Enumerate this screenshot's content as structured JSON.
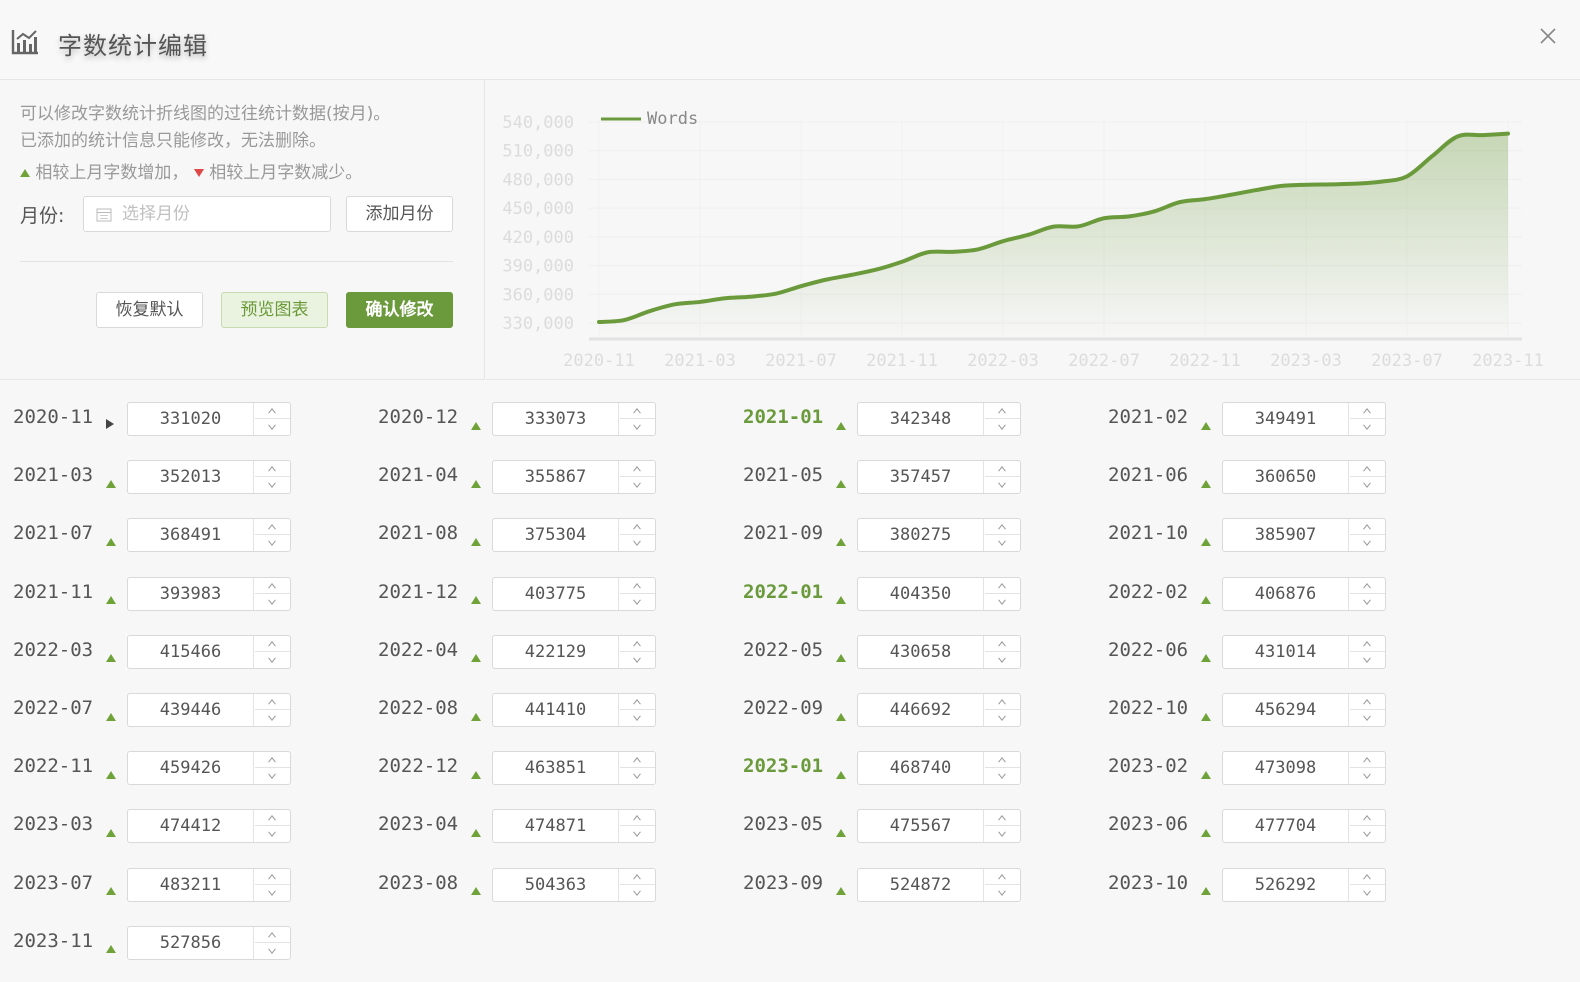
{
  "header": {
    "title": "字数统计编辑"
  },
  "panel": {
    "desc1": "可以修改字数统计折线图的过往统计数据(按月)。",
    "desc2": "已添加的统计信息只能修改，无法删除。",
    "legend_up": "相较上月字数增加，",
    "legend_down": "相较上月字数减少。",
    "month_label": "月份:",
    "month_placeholder": "选择月份",
    "add_month": "添加月份",
    "reset": "恢复默认",
    "preview": "预览图表",
    "confirm": "确认修改"
  },
  "colors": {
    "accent": "#6b9a3c",
    "up": "#6fa33a",
    "down": "#e04848"
  },
  "entries": [
    {
      "month": "2020-11",
      "value": "331020",
      "trend": "flat"
    },
    {
      "month": "2020-12",
      "value": "333073",
      "trend": "up"
    },
    {
      "month": "2021-01",
      "value": "342348",
      "trend": "up",
      "highlight": true
    },
    {
      "month": "2021-02",
      "value": "349491",
      "trend": "up"
    },
    {
      "month": "2021-03",
      "value": "352013",
      "trend": "up"
    },
    {
      "month": "2021-04",
      "value": "355867",
      "trend": "up"
    },
    {
      "month": "2021-05",
      "value": "357457",
      "trend": "up"
    },
    {
      "month": "2021-06",
      "value": "360650",
      "trend": "up"
    },
    {
      "month": "2021-07",
      "value": "368491",
      "trend": "up"
    },
    {
      "month": "2021-08",
      "value": "375304",
      "trend": "up"
    },
    {
      "month": "2021-09",
      "value": "380275",
      "trend": "up"
    },
    {
      "month": "2021-10",
      "value": "385907",
      "trend": "up"
    },
    {
      "month": "2021-11",
      "value": "393983",
      "trend": "up"
    },
    {
      "month": "2021-12",
      "value": "403775",
      "trend": "up"
    },
    {
      "month": "2022-01",
      "value": "404350",
      "trend": "up",
      "highlight": true
    },
    {
      "month": "2022-02",
      "value": "406876",
      "trend": "up"
    },
    {
      "month": "2022-03",
      "value": "415466",
      "trend": "up"
    },
    {
      "month": "2022-04",
      "value": "422129",
      "trend": "up"
    },
    {
      "month": "2022-05",
      "value": "430658",
      "trend": "up"
    },
    {
      "month": "2022-06",
      "value": "431014",
      "trend": "up"
    },
    {
      "month": "2022-07",
      "value": "439446",
      "trend": "up"
    },
    {
      "month": "2022-08",
      "value": "441410",
      "trend": "up"
    },
    {
      "month": "2022-09",
      "value": "446692",
      "trend": "up"
    },
    {
      "month": "2022-10",
      "value": "456294",
      "trend": "up"
    },
    {
      "month": "2022-11",
      "value": "459426",
      "trend": "up"
    },
    {
      "month": "2022-12",
      "value": "463851",
      "trend": "up"
    },
    {
      "month": "2023-01",
      "value": "468740",
      "trend": "up",
      "highlight": true
    },
    {
      "month": "2023-02",
      "value": "473098",
      "trend": "up"
    },
    {
      "month": "2023-03",
      "value": "474412",
      "trend": "up"
    },
    {
      "month": "2023-04",
      "value": "474871",
      "trend": "up"
    },
    {
      "month": "2023-05",
      "value": "475567",
      "trend": "up"
    },
    {
      "month": "2023-06",
      "value": "477704",
      "trend": "up"
    },
    {
      "month": "2023-07",
      "value": "483211",
      "trend": "up"
    },
    {
      "month": "2023-08",
      "value": "504363",
      "trend": "up"
    },
    {
      "month": "2023-09",
      "value": "524872",
      "trend": "up"
    },
    {
      "month": "2023-10",
      "value": "526292",
      "trend": "up"
    },
    {
      "month": "2023-11",
      "value": "527856",
      "trend": "up"
    }
  ],
  "chart_data": {
    "type": "line",
    "series": [
      {
        "name": "Words",
        "color": "#6b9a3c"
      }
    ],
    "x_ticks": [
      "2020-11",
      "2021-03",
      "2021-07",
      "2021-11",
      "2022-03",
      "2022-07",
      "2022-11",
      "2023-03",
      "2023-07",
      "2023-11"
    ],
    "y_ticks": [
      "330,000",
      "360,000",
      "390,000",
      "420,000",
      "450,000",
      "480,000",
      "510,000",
      "540,000"
    ],
    "ylim": [
      330000,
      540000
    ],
    "y_tick_values": [
      330000,
      360000,
      390000,
      420000,
      450000,
      480000,
      510000,
      540000
    ],
    "grid": true,
    "legend_position": "top-left",
    "values_source": "entries"
  }
}
